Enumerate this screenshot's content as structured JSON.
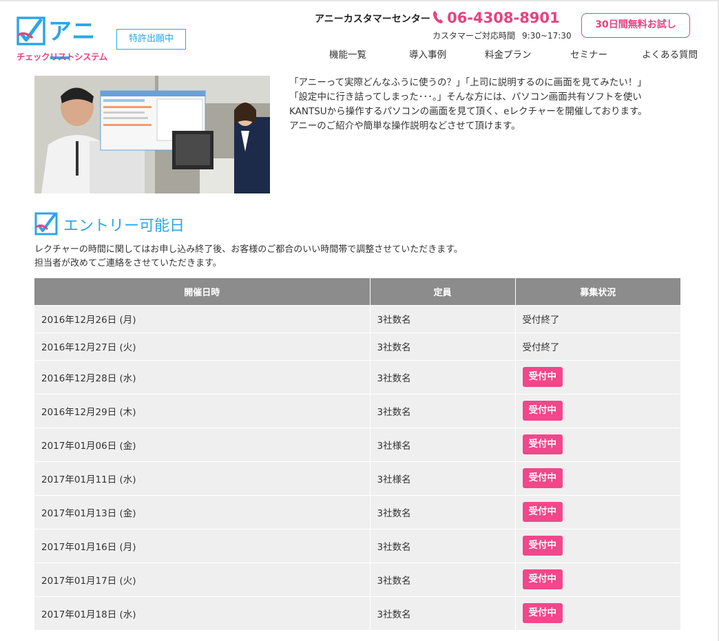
{
  "header": {
    "logo_name": "アニー",
    "logo_sub": "チェックリストシステム",
    "patent_label": "特許出願中",
    "customer_center": "アニーカスタマーセンター",
    "phone": "06-4308-8901",
    "hours_label": "カスタマーご対応時間",
    "hours": "9:30~17:30",
    "trial_button": "30日間無料お試し"
  },
  "nav": {
    "items": [
      "機能一覧",
      "導入事例",
      "料金プラン",
      "セミナー",
      "よくある質問"
    ]
  },
  "intro": {
    "lines": [
      "「アニーって実際どんなふうに使うの？」「上司に説明するのに画面を見てみたい！」",
      "「設定中に行き詰ってしまった･･･。」そんな方には、パソコン画面共有ソフトを使い",
      "KANTSUから操作するパソコンの画面を見て頂く、eレクチャーを開催しております。",
      "アニーのご紹介や簡単な操作説明などさせて頂けます。"
    ]
  },
  "section": {
    "title": "エントリー可能日",
    "desc": [
      "レクチャーの時間に関してはお申し込み終了後、お客様のご都合のいい時間帯で調整させていただきます。",
      "担当者が改めてご連絡をさせていただきます。"
    ]
  },
  "table": {
    "headers": [
      "開催日時",
      "定員",
      "募集状況"
    ],
    "rows": [
      {
        "date": "2016年12月26日 (月)",
        "capacity": "3社数名",
        "status": "受付終了",
        "open": false
      },
      {
        "date": "2016年12月27日 (火)",
        "capacity": "3社数名",
        "status": "受付終了",
        "open": false
      },
      {
        "date": "2016年12月28日 (水)",
        "capacity": "3社数名",
        "status": "受付中",
        "open": true
      },
      {
        "date": "2016年12月29日 (木)",
        "capacity": "3社数名",
        "status": "受付中",
        "open": true
      },
      {
        "date": "2017年01月06日 (金)",
        "capacity": "3社様名",
        "status": "受付中",
        "open": true
      },
      {
        "date": "2017年01月11日 (水)",
        "capacity": "3社様名",
        "status": "受付中",
        "open": true
      },
      {
        "date": "2017年01月13日 (金)",
        "capacity": "3社数名",
        "status": "受付中",
        "open": true
      },
      {
        "date": "2017年01月16日 (月)",
        "capacity": "3社数名",
        "status": "受付中",
        "open": true
      },
      {
        "date": "2017年01月17日 (火)",
        "capacity": "3社数名",
        "status": "受付中",
        "open": true
      },
      {
        "date": "2017年01月18日 (水)",
        "capacity": "3社数名",
        "status": "受付中",
        "open": true
      }
    ]
  },
  "colors": {
    "brand_blue": "#2aa6e8",
    "brand_pink": "#e8427f",
    "badge_pink": "#f2478a",
    "header_gray": "#8c8c8c",
    "row_gray": "#efefef"
  }
}
